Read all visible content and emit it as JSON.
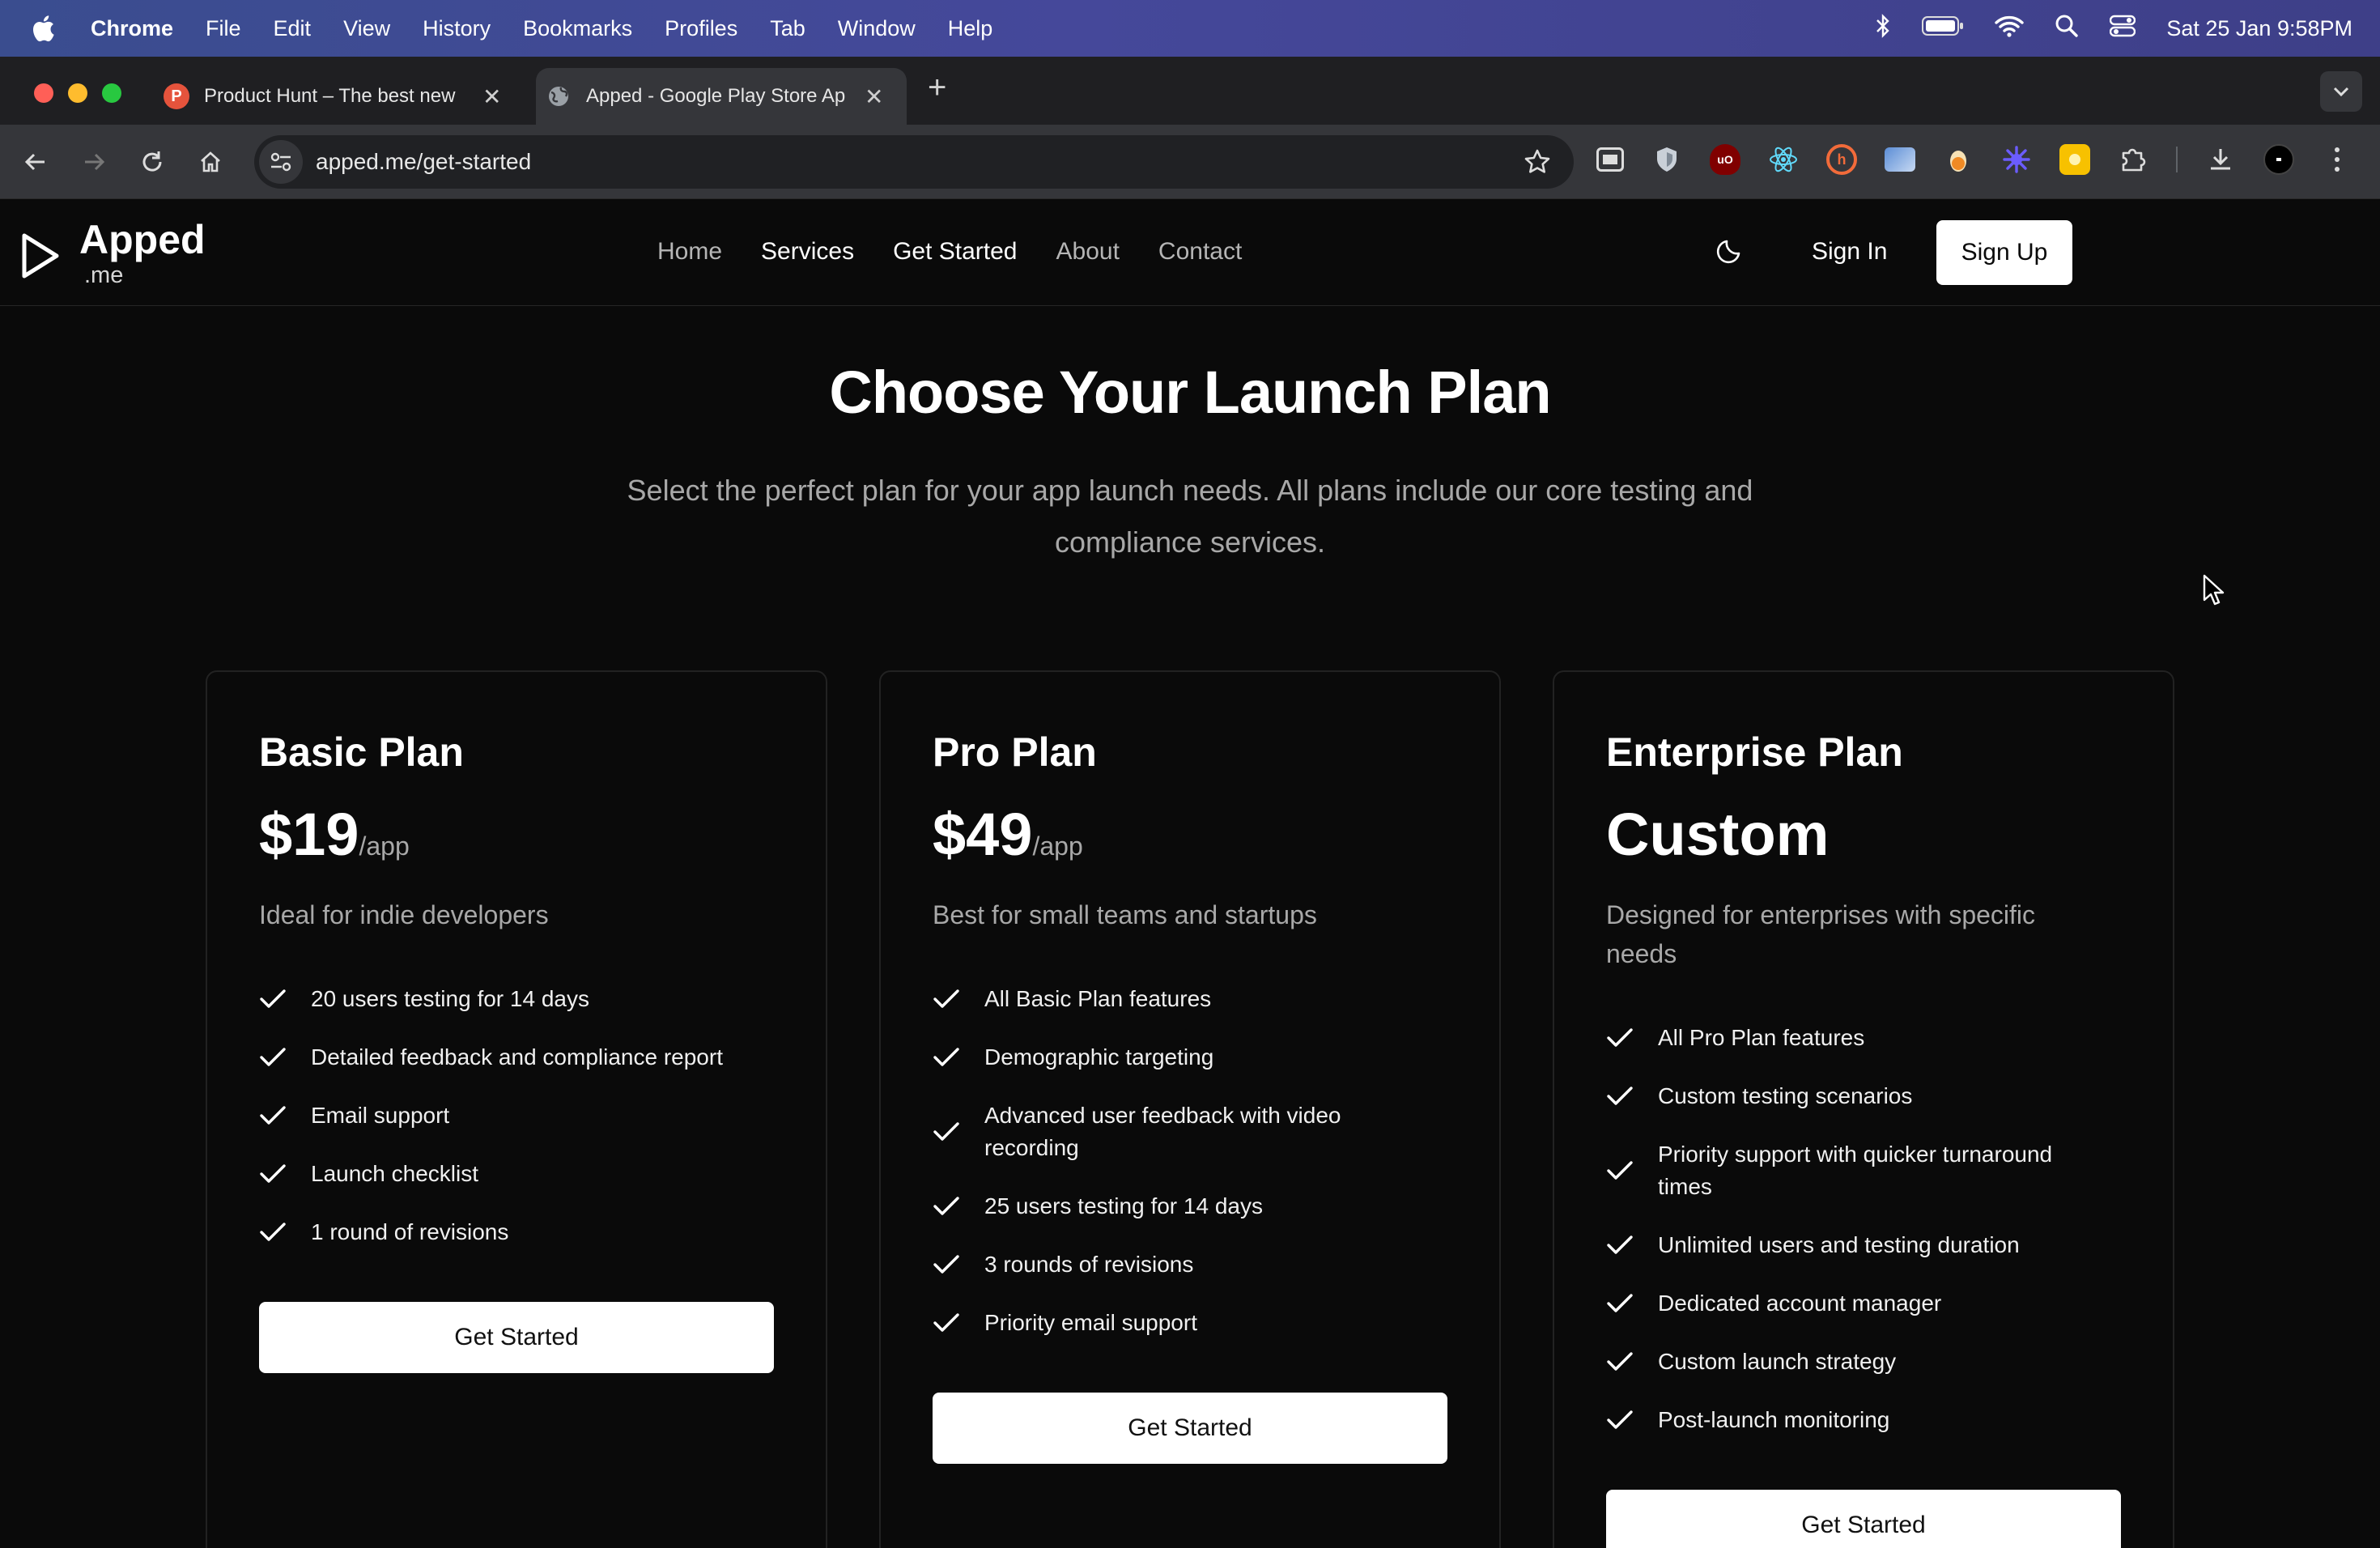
{
  "menubar": {
    "app": "Chrome",
    "items": [
      "File",
      "Edit",
      "View",
      "History",
      "Bookmarks",
      "Profiles",
      "Tab",
      "Window",
      "Help"
    ],
    "datetime": "Sat 25 Jan  9:58PM"
  },
  "tabs": [
    {
      "title": "Product Hunt – The best new",
      "favicon": "P",
      "favicon_color": "#e5533c"
    },
    {
      "title": "Apped - Google Play Store Ap",
      "favicon": "globe-icon"
    }
  ],
  "toolbar": {
    "url": "apped.me/get-started"
  },
  "site": {
    "logo": {
      "name": "Apped",
      "sub": ".me"
    },
    "nav": [
      "Home",
      "Services",
      "Get Started",
      "About",
      "Contact"
    ],
    "sign_in": "Sign In",
    "sign_up": "Sign Up"
  },
  "hero": {
    "title": "Choose Your Launch Plan",
    "lede": "Select the perfect plan for your app launch needs. All plans include our core testing and compliance services."
  },
  "plans": [
    {
      "name": "Basic Plan",
      "price": "$19",
      "per": "/app",
      "description": "Ideal for indie developers",
      "features": [
        "20 users testing for 14 days",
        "Detailed feedback and compliance report",
        "Email support",
        "Launch checklist",
        "1 round of revisions"
      ],
      "cta": "Get Started"
    },
    {
      "name": "Pro Plan",
      "price": "$49",
      "per": "/app",
      "description": "Best for small teams and startups",
      "features": [
        "All Basic Plan features",
        "Demographic targeting",
        "Advanced user feedback with video recording",
        "25 users testing for 14 days",
        "3 rounds of revisions",
        "Priority email support"
      ],
      "cta": "Get Started"
    },
    {
      "name": "Enterprise Plan",
      "price": "Custom",
      "per": "",
      "description": "Designed for enterprises with specific needs",
      "features": [
        "All Pro Plan features",
        "Custom testing scenarios",
        "Priority support with quicker turnaround times",
        "Unlimited users and testing duration",
        "Dedicated account manager",
        "Custom launch strategy",
        "Post-launch monitoring"
      ],
      "cta": "Get Started"
    }
  ],
  "colors": {
    "accent": "#ffffff",
    "background": "#0a0a0a",
    "muted": "#a8a8a8"
  }
}
